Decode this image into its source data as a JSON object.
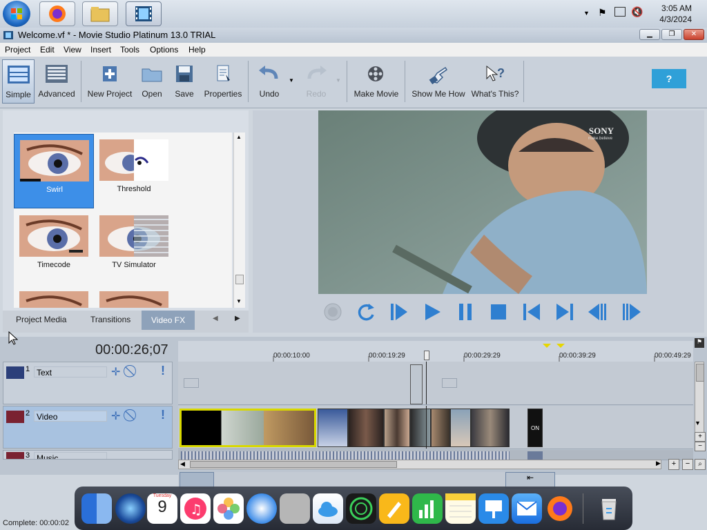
{
  "taskbar": {
    "clock_time": "3:05 AM",
    "clock_date": "4/3/2024"
  },
  "window": {
    "title": "Welcome.vf * - Movie Studio Platinum 13.0 TRIAL"
  },
  "menu": [
    "Project",
    "Edit",
    "View",
    "Insert",
    "Tools",
    "Options",
    "Help"
  ],
  "toolbar": {
    "simple": "Simple",
    "advanced": "Advanced",
    "new_project": "New Project",
    "open": "Open",
    "save": "Save",
    "properties": "Properties",
    "undo": "Undo",
    "redo": "Redo",
    "make_movie": "Make Movie",
    "show_me_how": "Show Me How",
    "whats_this": "What's This?",
    "help_bubble": "?"
  },
  "fx": {
    "items": [
      "Swirl",
      "Threshold",
      "Timecode",
      "TV Simulator"
    ],
    "tabs": [
      "Project Media",
      "Transitions",
      "Video FX"
    ]
  },
  "preview": {
    "watermark": "SONY",
    "watermark_sub": "make.believe"
  },
  "timeline": {
    "timecode": "00:00:26;07",
    "ticks": [
      "00:00:10:00",
      "00:00:19:29",
      "00:00:29:29",
      "00:00:39:29",
      "00:00:49:29"
    ],
    "tracks": [
      {
        "number": "1",
        "name": "Text"
      },
      {
        "number": "2",
        "name": "Video"
      },
      {
        "number": "3",
        "name": "Music"
      }
    ]
  },
  "status": {
    "text": "Complete: 00:00:02"
  },
  "dock": {
    "calendar_day": "9",
    "calendar_month": "Tuesday"
  }
}
